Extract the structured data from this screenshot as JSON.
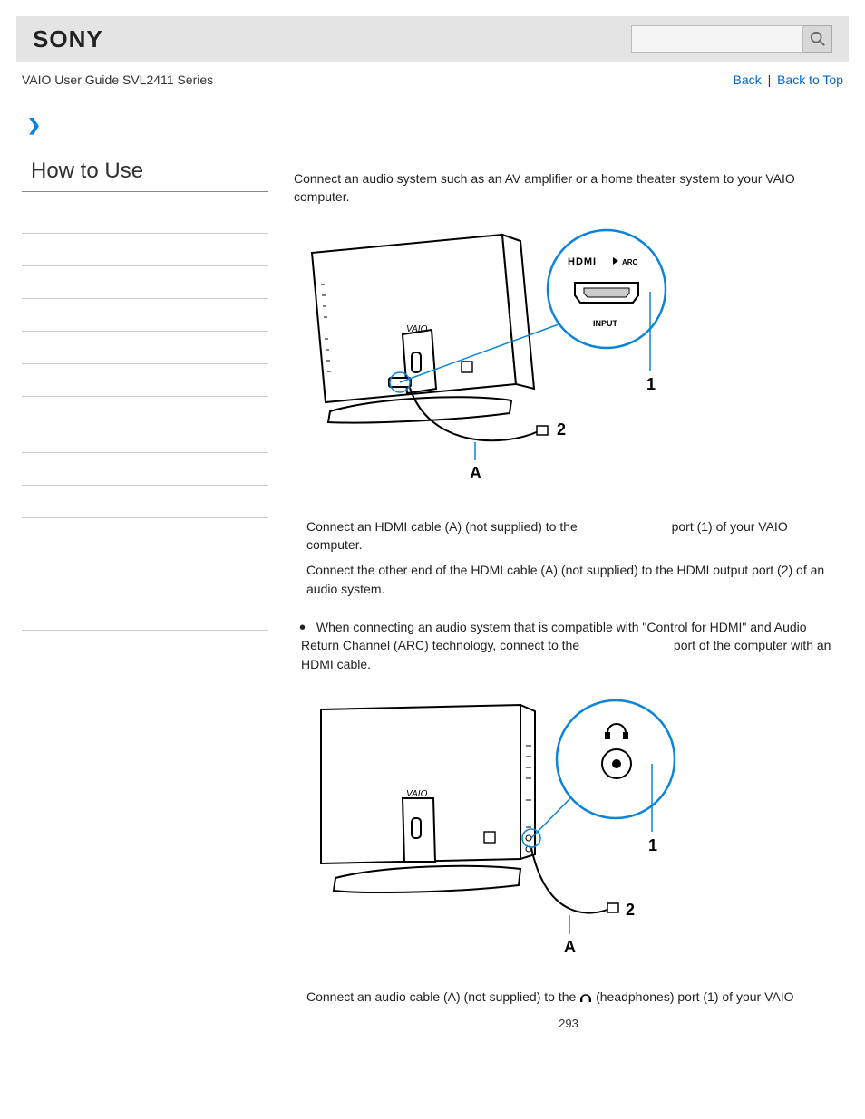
{
  "header": {
    "brand": "SONY",
    "search_placeholder": ""
  },
  "breadcrumb": {
    "guide": "VAIO User Guide SVL2411 Series",
    "back": "Back",
    "back_to_top": "Back to Top"
  },
  "sidebar": {
    "title": "How to Use"
  },
  "content": {
    "intro": "Connect an audio system such as an AV amplifier or a home theater system to your VAIO computer.",
    "fig1": {
      "hdmi": "HDMI",
      "arc": "ARC",
      "input": "INPUT",
      "vaio": "VAIO",
      "n1": "1",
      "n2": "2",
      "a": "A"
    },
    "step1a": "Connect an HDMI cable (A) (not supplied) to the ",
    "step1b": " port (1) of your VAIO computer.",
    "step2": "Connect the other end of the HDMI cable (A) (not supplied) to the HDMI output port (2) of an audio system.",
    "bullet_a": "When connecting an audio system that is compatible with \"Control for HDMI\" and Audio Return Channel (ARC) technology, connect to the ",
    "bullet_b": " port of the computer with an HDMI cable.",
    "fig2": {
      "vaio": "VAIO",
      "n1": "1",
      "n2": "2",
      "a": "A"
    },
    "step3a": "Connect an audio cable (A) (not supplied) to the ",
    "step3b": "(headphones) port (1) of your VAIO",
    "page_number": "293"
  }
}
